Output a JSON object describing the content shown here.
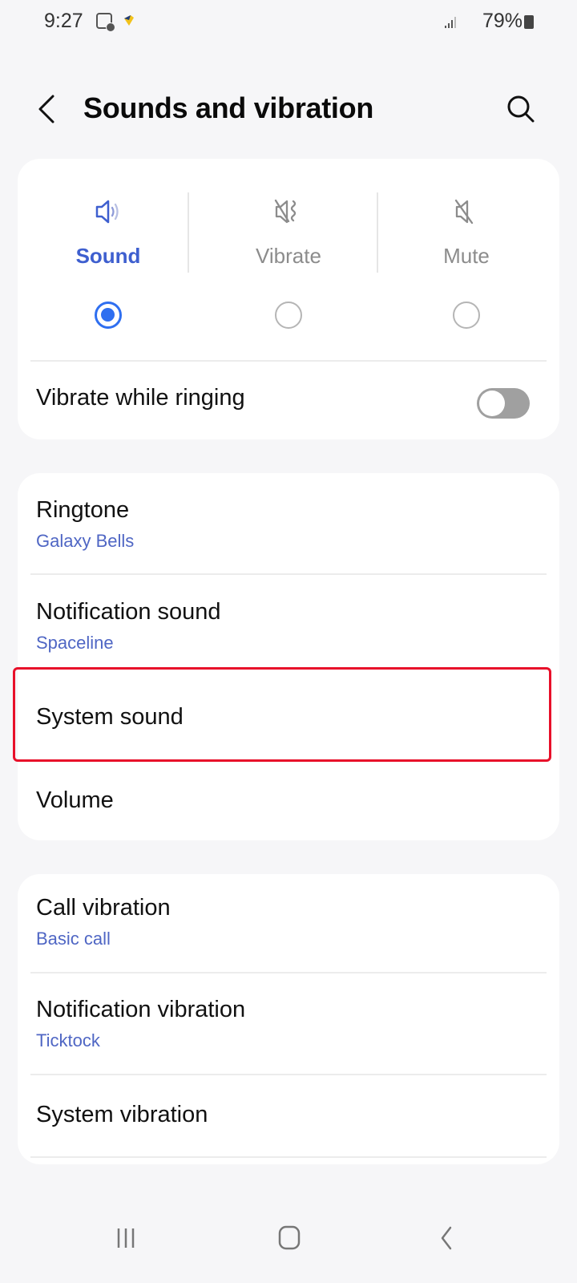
{
  "status_bar": {
    "time": "9:27",
    "battery": "79%",
    "icons": [
      "message-notification-icon",
      "app-notification-icon",
      "signal-icon",
      "battery-icon"
    ]
  },
  "header": {
    "title": "Sounds and vibration",
    "back_icon": "chevron-left-icon",
    "search_icon": "search-icon"
  },
  "sound_mode": {
    "options": [
      {
        "label": "Sound",
        "icon": "speaker-icon",
        "selected": true
      },
      {
        "label": "Vibrate",
        "icon": "vibrate-muted-speaker-icon",
        "selected": false
      },
      {
        "label": "Mute",
        "icon": "muted-speaker-icon",
        "selected": false
      }
    ],
    "vibrate_while_ringing": {
      "label": "Vibrate while ringing",
      "enabled": false
    }
  },
  "sounds_section": {
    "items": [
      {
        "title": "Ringtone",
        "subtitle": "Galaxy Bells"
      },
      {
        "title": "Notification sound",
        "subtitle": "Spaceline"
      },
      {
        "title": "System sound",
        "highlighted": true
      },
      {
        "title": "Volume"
      }
    ]
  },
  "vibration_section": {
    "items": [
      {
        "title": "Call vibration",
        "subtitle": "Basic call"
      },
      {
        "title": "Notification vibration",
        "subtitle": "Ticktock"
      },
      {
        "title": "System vibration"
      }
    ]
  },
  "nav_bar": {
    "buttons": [
      "recents-icon",
      "home-icon",
      "back-icon"
    ]
  },
  "colors": {
    "accent": "#2f6ff0",
    "subtitle": "#4f66c4",
    "highlight_border": "#e8102a",
    "background": "#f6f6f8"
  }
}
